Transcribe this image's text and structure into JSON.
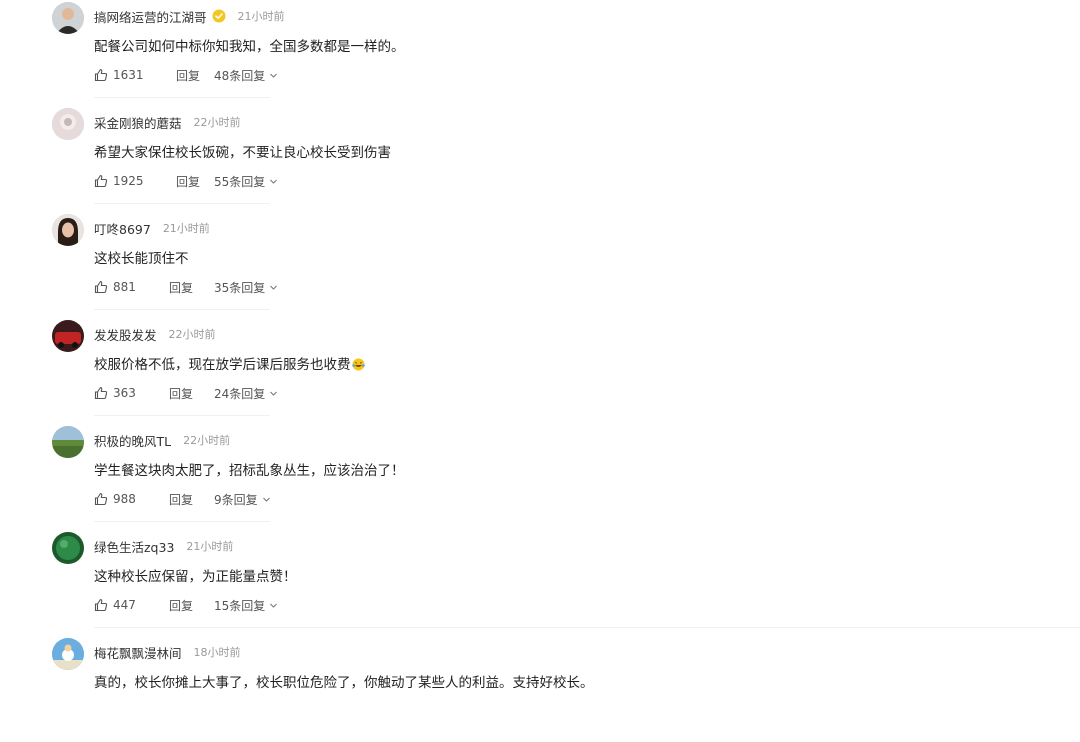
{
  "comments": [
    {
      "username": "搞网络运营的江湖哥",
      "verified": true,
      "time": "21小时前",
      "text": "配餐公司如何中标你知我知，全国多数都是一样的。",
      "likes": "1631",
      "reply_label": "回复",
      "replies_label": "48条回复",
      "avatar_color": "#3a3a3a"
    },
    {
      "username": "采金刚狼的蘑菇",
      "time": "22小时前",
      "text": "希望大家保住校长饭碗，不要让良心校长受到伤害",
      "likes": "1925",
      "reply_label": "回复",
      "replies_label": "55条回复",
      "avatar_color": "#d8c8c8"
    },
    {
      "username": "叮咚8697",
      "time": "21小时前",
      "text": "这校长能顶住不",
      "likes": "881",
      "reply_label": "回复",
      "replies_label": "35条回复",
      "avatar_color": "#8a5a4a"
    },
    {
      "username": "发发股发发",
      "time": "22小时前",
      "text": "校服价格不低，现在放学后课后服务也收费",
      "emoji": "laughing-tears-icon",
      "likes": "363",
      "reply_label": "回复",
      "replies_label": "24条回复",
      "avatar_color": "#a02020"
    },
    {
      "username": "积极的晚风TL",
      "time": "22小时前",
      "text": "学生餐这块肉太肥了，招标乱象丛生，应该治治了！",
      "likes": "988",
      "reply_label": "回复",
      "replies_label": "9条回复",
      "avatar_color": "#6a8a4a"
    },
    {
      "username": "绿色生活zq33",
      "time": "21小时前",
      "text": "这种校长应保留，为正能量点赞！",
      "likes": "447",
      "reply_label": "回复",
      "replies_label": "15条回复",
      "avatar_color": "#1f7a3a"
    },
    {
      "username": "梅花飘飘漫林间",
      "time": "18小时前",
      "text": "真的，校长你摊上大事了，校长职位危险了，你触动了某些人的利益。支持好校长。",
      "avatar_color": "#4a90c8"
    }
  ],
  "colors": {
    "username": "#333333",
    "time": "#9a9a9a",
    "text": "#222222",
    "verified_badge": "#f3c623"
  }
}
